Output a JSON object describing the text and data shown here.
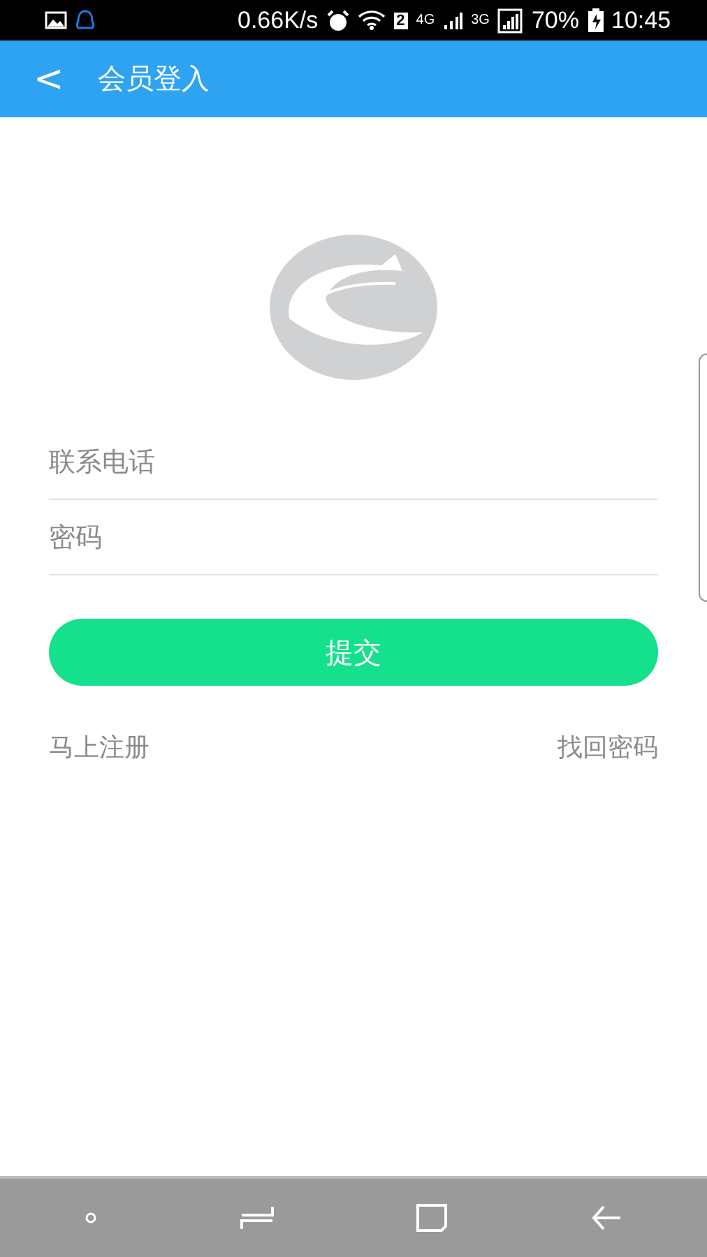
{
  "status_bar": {
    "speed": "0.66K/s",
    "sim_badge": "2",
    "network_1": "4G",
    "network_2": "3G",
    "battery": "70%",
    "time": "10:45"
  },
  "header": {
    "back": "<",
    "title": "会员登入"
  },
  "form": {
    "fields": [
      {
        "placeholder": "联系电话"
      },
      {
        "placeholder": "密码"
      }
    ],
    "submit": "提交"
  },
  "links": {
    "register": "马上注册",
    "recover": "找回密码"
  }
}
